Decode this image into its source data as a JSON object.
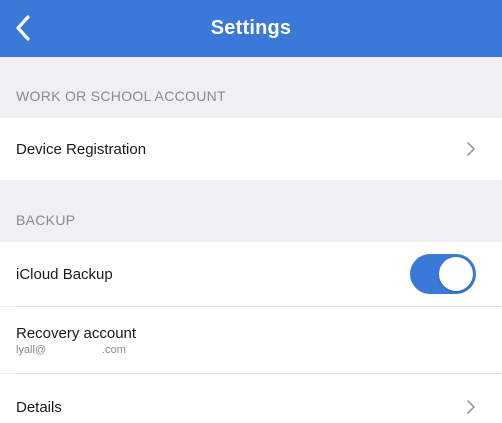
{
  "header": {
    "title": "Settings",
    "back_icon": "chevron-left-icon",
    "background_color": "#3b79d8"
  },
  "sections": {
    "work_school": {
      "header": "WORK OR SCHOOL ACCOUNT",
      "device_registration": {
        "label": "Device Registration",
        "icon": "chevron-right-icon"
      }
    },
    "backup": {
      "header": "BACKUP",
      "icloud_backup": {
        "label": "iCloud Backup",
        "toggle_on": true,
        "toggle_color": "#3b79d8"
      },
      "recovery_account": {
        "label": "Recovery account",
        "email_prefix": "lyall@",
        "email_suffix": ".com"
      },
      "details": {
        "label": "Details",
        "icon": "chevron-right-icon"
      }
    }
  }
}
